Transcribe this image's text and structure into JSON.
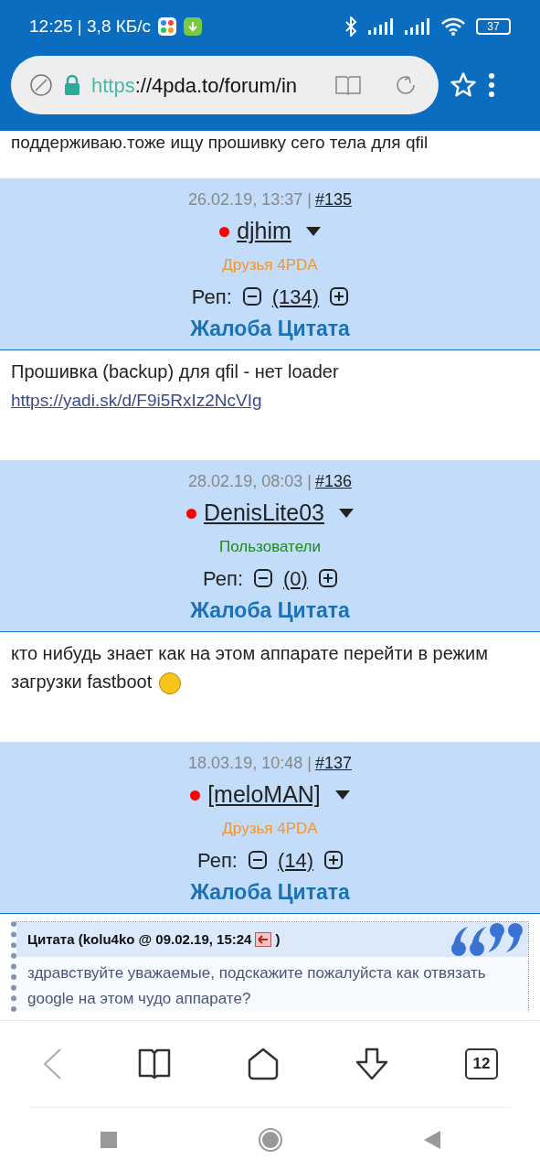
{
  "status_bar": {
    "time_speed": "12:25 | 3,8 КБ/с",
    "battery": "37"
  },
  "address_bar": {
    "scheme": "https",
    "rest": "://4pda.to/forum/in"
  },
  "top_text": "поддерживаю.тоже ищу прошивку сего тела для qfil",
  "posts": [
    {
      "date": "26.02.19, 13:37 |",
      "number": "#135",
      "author": "djhim",
      "dot": {
        "color": "#ff0000"
      },
      "group": {
        "text": "Друзья 4PDA",
        "color": "#f0962e"
      },
      "rep_label": "Реп:",
      "rep": "(134)",
      "actions": "Жалоба Цитата",
      "body": [
        {
          "kind": "text",
          "text": "Прошивка (backup) для qfil - нет loader"
        },
        {
          "kind": "link",
          "text": "https://yadi.sk/d/F9i5RxIz2NcVIg"
        }
      ]
    },
    {
      "date": "28.02.19, 08:03 |",
      "number": "#136",
      "author": "DenisLite03",
      "dot": {
        "color": "#ff0000"
      },
      "group": {
        "text": "Пользователи",
        "color": "#1d8a1d"
      },
      "rep_label": "Реп:",
      "rep": "(0)",
      "actions": "Жалоба Цитата",
      "body": [
        {
          "kind": "text",
          "text": "кто нибудь знает как на этом аппарате перейти в режим загрузки fastboot",
          "emoji": true
        }
      ]
    },
    {
      "date": "18.03.19, 10:48 |",
      "number": "#137",
      "author": "[meloMAN]",
      "dot": {
        "color": "#ff0000"
      },
      "group": {
        "text": "Друзья 4PDA",
        "color": "#f0962e"
      },
      "rep_label": "Реп:",
      "rep": "(14)",
      "actions": "Жалоба Цитата",
      "body": [
        {
          "kind": "quote",
          "title": "Цитата (kolu4ko @ 09.02.19, 15:24",
          "close": ")",
          "text": "здравствуйте уважаемые, подскажите пожалуйста как отвязать google на этом чудо аппарате?"
        }
      ]
    }
  ],
  "tab_count": "12"
}
